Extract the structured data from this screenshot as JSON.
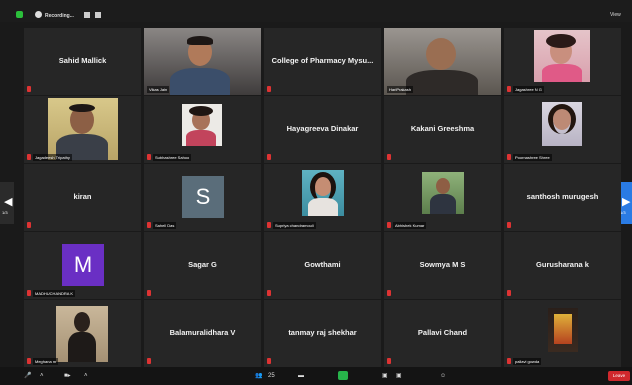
{
  "topbar": {
    "recording_label": "Recording...",
    "view_label": "View"
  },
  "pager": {
    "left_page": "1/3",
    "right_page": "1/3"
  },
  "tiles": {
    "r1c1": {
      "name": "Sahid Mallick"
    },
    "r1c2": {
      "label": "Vikas Jain"
    },
    "r1c3": {
      "name": "College of Pharmacy Mysu..."
    },
    "r1c4": {
      "label": "HariPrakash"
    },
    "r1c5": {
      "label": "Jagashree N G"
    },
    "r2c1": {
      "label": "Jagadeesh Tripathy"
    },
    "r2c2": {
      "label": "Subhashree Sahoo"
    },
    "r2c3": {
      "name": "Hayagreeva Dinakar"
    },
    "r2c4": {
      "name": "Kakani Greeshma"
    },
    "r2c5": {
      "label": "Poornashree Shree"
    },
    "r3c1": {
      "name": "kiran"
    },
    "r3c2": {
      "avatar": "S",
      "label": "Sahell Das"
    },
    "r3c3": {
      "label": "Supriya chandramouli"
    },
    "r3c4": {
      "label": "Abhishek Kumar"
    },
    "r3c5": {
      "name": "santhosh murugesh"
    },
    "r4c1": {
      "avatar": "M",
      "label": "MADHUCHANDRA K"
    },
    "r4c2": {
      "name": "Sagar G"
    },
    "r4c3": {
      "name": "Gowthami"
    },
    "r4c4": {
      "name": "Sowmya M S"
    },
    "r4c5": {
      "name": "Gurusharana k"
    },
    "r5c1": {
      "label": "Meghana m"
    },
    "r5c2": {
      "name": "Balamuralidhara V"
    },
    "r5c3": {
      "name": "tanmay raj shekhar"
    },
    "r5c4": {
      "name": "Pallavi Chand"
    },
    "r5c5": {
      "label": "pallavi gowda"
    }
  },
  "toolbar": {
    "participants_count": "25",
    "leave_label": "Leave"
  },
  "colors": {
    "speaking_border": "#d7e34a",
    "pager_active": "#2a7be4",
    "leave": "#d0282d",
    "avatar_s": "#5a6d7a",
    "avatar_m": "#6a2fc4"
  }
}
